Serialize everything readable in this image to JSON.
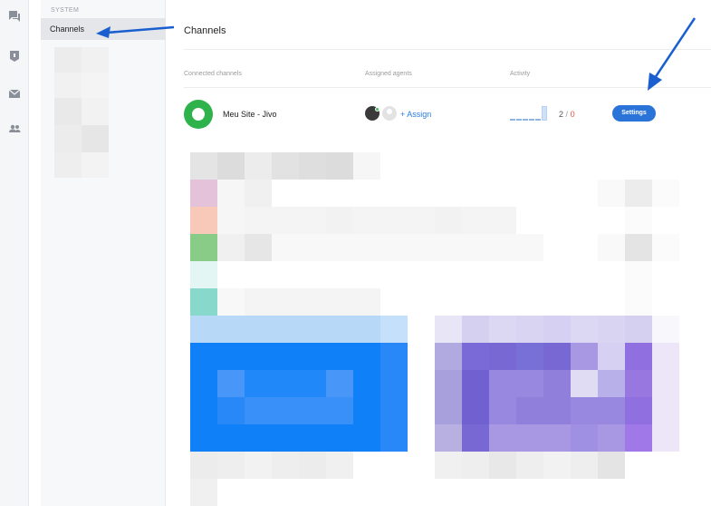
{
  "rail": {
    "icons": [
      "chat-icon",
      "inbox-icon",
      "mail-icon",
      "team-icon"
    ]
  },
  "sidebar": {
    "section_label": "SYSTEM",
    "items": [
      {
        "label": "Channels",
        "active": true
      }
    ]
  },
  "main": {
    "title": "Channels",
    "columns": {
      "connected": "Connected channels",
      "agents": "Assigned agents",
      "activity": "Activity"
    },
    "channels": [
      {
        "name": "Meu Site - Jivo",
        "assign_label": "+ Assign",
        "activity_bar_levels": [
          0.1,
          0.1,
          0.1,
          0.1,
          0.1,
          1.0
        ],
        "activity_ok": "2",
        "activity_sep": "/",
        "activity_failed": "0",
        "settings_label": "Settings"
      }
    ]
  },
  "colors": {
    "accent": "#2a73d9",
    "link": "#2b7ce0",
    "channel_logo": "#2fb24b",
    "error": "#e5534b",
    "annotation_arrow": "#1a5fcf"
  }
}
